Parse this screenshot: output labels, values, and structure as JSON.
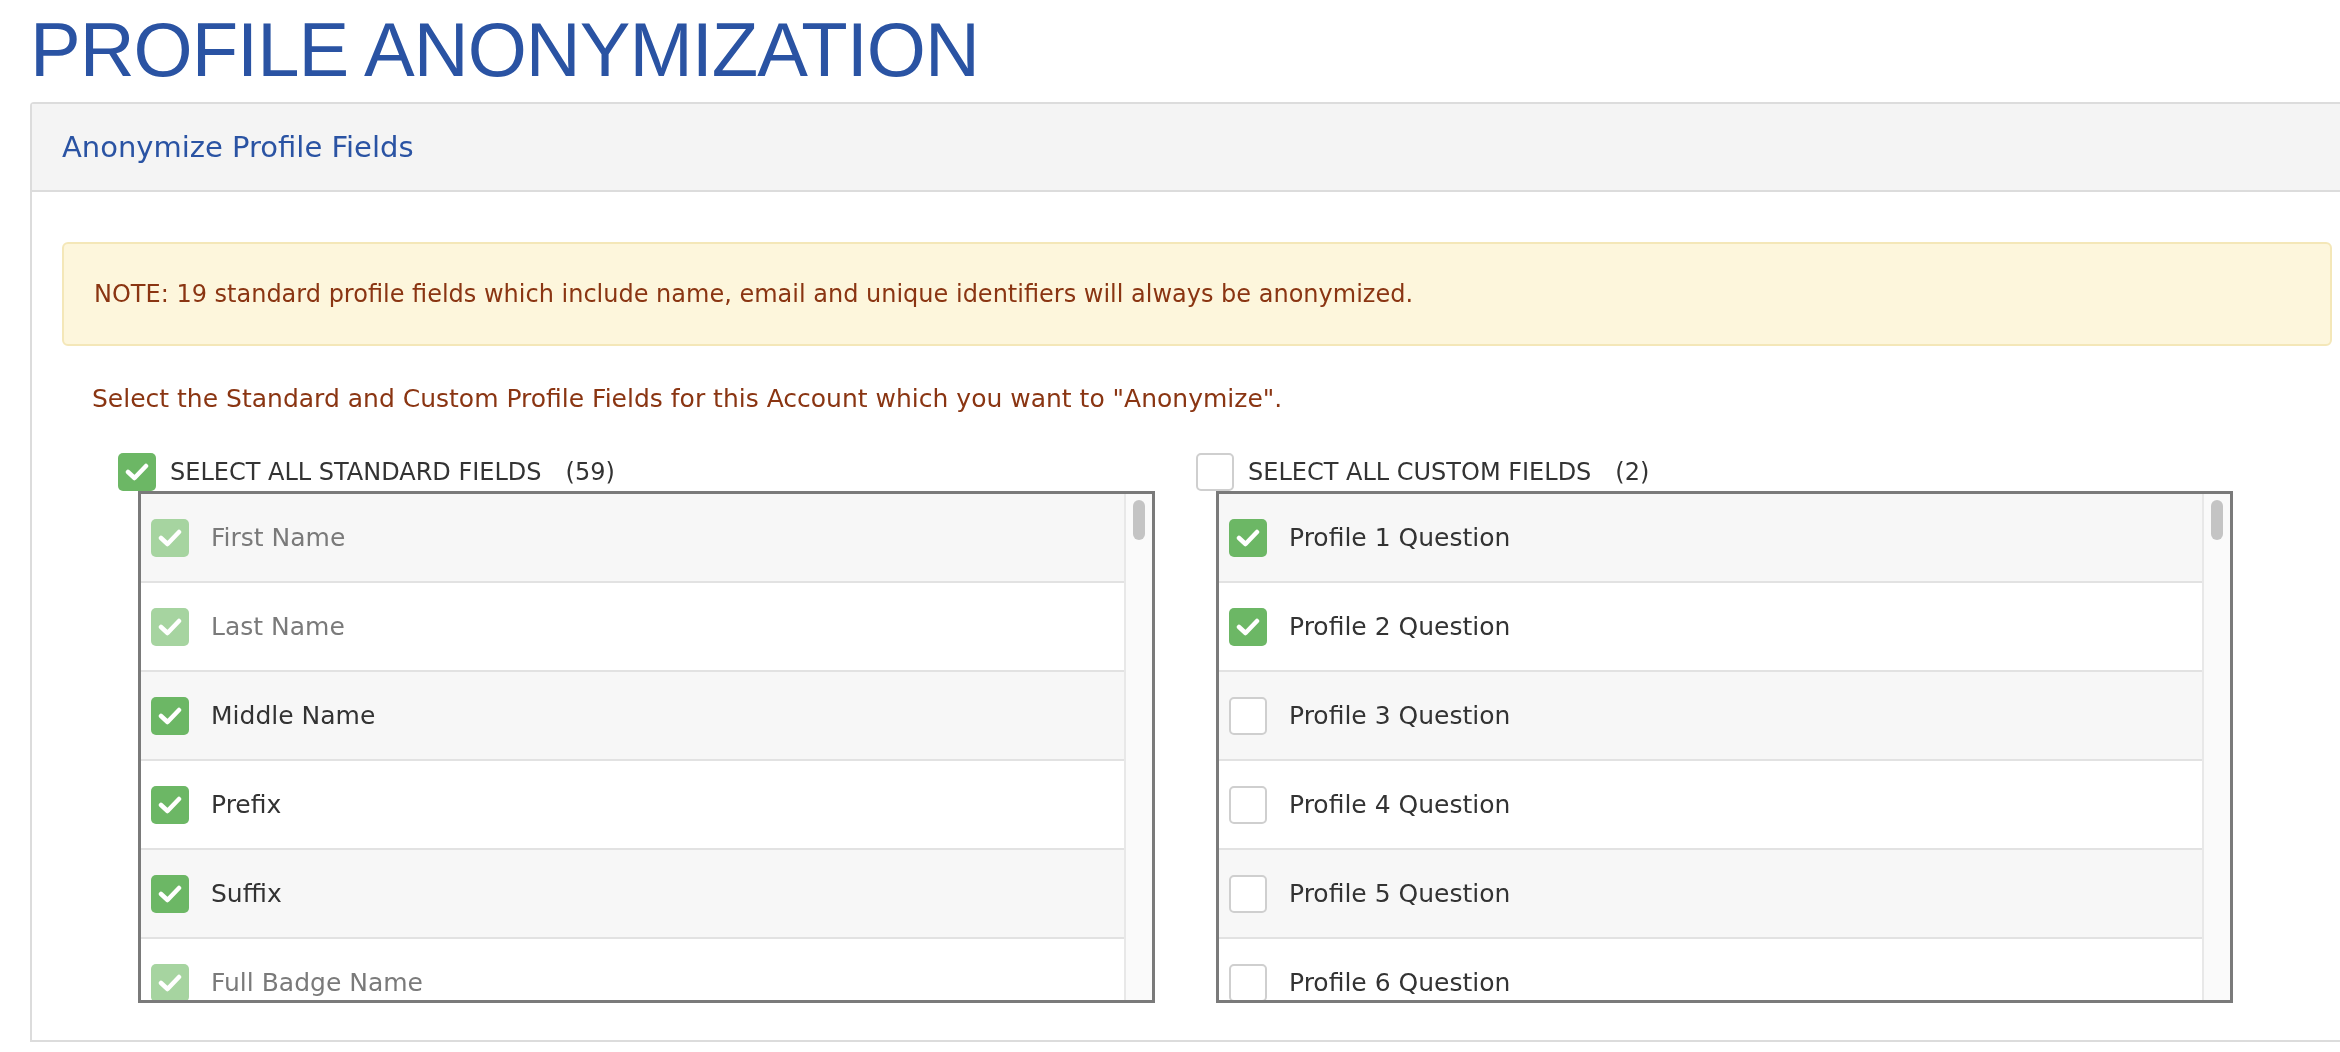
{
  "page_title": "PROFILE ANONYMIZATION",
  "panel": {
    "title": "Anonymize Profile Fields",
    "note": "NOTE: 19 standard profile fields which include name, email and unique identifiers will always be anonymized.",
    "instruction": "Select the Standard and Custom Profile Fields for this Account which you want to \"Anonymize\".",
    "lists": [
      {
        "select_all": {
          "label": "SELECT ALL STANDARD FIELDS",
          "count": "(59)",
          "checked": true
        },
        "items": [
          {
            "label": "First Name",
            "checked": true,
            "disabled": true
          },
          {
            "label": "Last Name",
            "checked": true,
            "disabled": true
          },
          {
            "label": "Middle Name",
            "checked": true,
            "disabled": false
          },
          {
            "label": "Prefix",
            "checked": true,
            "disabled": false
          },
          {
            "label": "Suffix",
            "checked": true,
            "disabled": false
          },
          {
            "label": "Full Badge Name",
            "checked": true,
            "disabled": true
          }
        ]
      },
      {
        "select_all": {
          "label": "SELECT ALL CUSTOM FIELDS",
          "count": "(2)",
          "checked": false
        },
        "items": [
          {
            "label": "Profile 1 Question",
            "checked": true,
            "disabled": false
          },
          {
            "label": "Profile 2 Question",
            "checked": true,
            "disabled": false
          },
          {
            "label": "Profile 3 Question",
            "checked": false,
            "disabled": false
          },
          {
            "label": "Profile 4 Question",
            "checked": false,
            "disabled": false
          },
          {
            "label": "Profile 5 Question",
            "checked": false,
            "disabled": false
          },
          {
            "label": "Profile 6 Question",
            "checked": false,
            "disabled": false
          }
        ]
      }
    ]
  }
}
